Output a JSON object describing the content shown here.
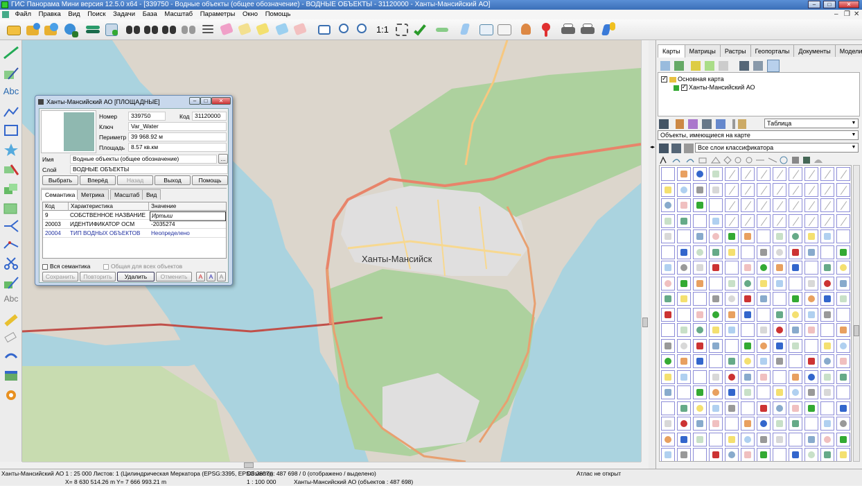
{
  "window": {
    "title": "ГИС Панорама Мини версия 12.5.0 x64 - [339750 - Водные объекты (общее обозначение) - ВОДНЫЕ ОБЪЕКТЫ - 31120000 - Ханты-Мансийский АО]",
    "min": "–",
    "max": "□",
    "close": "✕"
  },
  "menu": [
    "Файл",
    "Правка",
    "Вид",
    "Поиск",
    "Задачи",
    "База",
    "Масштаб",
    "Параметры",
    "Окно",
    "Помощь"
  ],
  "mdi_controls": {
    "min": "–",
    "restore": "❐",
    "close": "✕"
  },
  "toolbar": {
    "scale_1_1": "1:1"
  },
  "left_toolbar": {
    "text_tool_1": "Abc",
    "text_tool_2": "Abc"
  },
  "map": {
    "city_label": "Ханты-Мансийск",
    "colors": {
      "water": "#aad3df",
      "land": "#dcd6cc",
      "forest": "#add19e",
      "road_primary": "#e8846a",
      "road_secondary": "#f7c880",
      "urban": "#e0dfdf"
    }
  },
  "dialog": {
    "title": "Ханты-Мансийский АО [ПЛОЩАДНЫЕ]",
    "labels": {
      "number": "Номер",
      "code": "Код",
      "key": "Ключ",
      "perimeter": "Периметр",
      "area": "Площадь",
      "name": "Имя",
      "layer": "Слой"
    },
    "values": {
      "number": "339750",
      "code": "31120000",
      "key": "Var_Water",
      "perimeter": "39 968.92 м",
      "area": "8.57 кв.км",
      "name": "Водные объекты (общее обозначение)",
      "layer": "ВОДНЫЕ ОБЪЕКТЫ"
    },
    "name_button": "...",
    "nav_buttons": [
      "Выбрать",
      "Вперёд",
      "Назад",
      "Выход",
      "Помощь"
    ],
    "tabs": [
      "Семантика",
      "Метрика",
      "Масштаб",
      "Вид"
    ],
    "table": {
      "headers": [
        "Код",
        "Характеристика",
        "Значение"
      ],
      "rows": [
        [
          "9",
          "СОБСТВЕННОЕ НАЗВАНИЕ",
          "Иртыш"
        ],
        [
          "20003",
          "ИДЕНТИФИКАТОР ОСМ",
          "-2035274"
        ],
        [
          "20004",
          "ТИП ВОДНЫХ ОБЪЕКТОВ",
          "Неопределено"
        ]
      ]
    },
    "checkbox_all_semantics": "Вся семантика",
    "checkbox_common": "Общая для всех объектов",
    "bottom_buttons": [
      "Сохранить",
      "Повторить",
      "Удалить",
      "Отменить"
    ],
    "font_buttons": [
      "A",
      "A",
      "A"
    ]
  },
  "right_panel": {
    "tabs": [
      "Карты",
      "Матрицы",
      "Растры",
      "Геопорталы",
      "Документы",
      "Модели"
    ],
    "tree": {
      "root": "Основная карта",
      "child": "Ханты-Мансийский АО"
    },
    "view_combo": "Таблица",
    "objects_combo": "Объекты, имеющиеся на карте",
    "layers_combo": "Все слои классификатора"
  },
  "status": {
    "map_info": "Ханты-Мансийский АО  1 : 25 000  Листов: 1  (Цилиндрическая Меркатора (EPSG:3395, EPSG:3857))",
    "objects": "Объектов: 487 698 / 0 (отображено / выделено)",
    "atlas": "Атлас не открыт",
    "coord_x": "X= 8 630 514.26 m",
    "coord_y": "Y= 7 666 993.21 m",
    "scale": "1 : 100 000",
    "current_map": "Ханты-Мансийский АО  (объектов : 487 698)"
  }
}
